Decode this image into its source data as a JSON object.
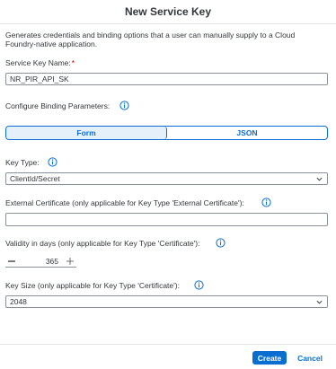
{
  "dialog": {
    "title": "New Service Key",
    "description": "Generates credentials and binding options that a user can manually supply to a Cloud Foundry-native application."
  },
  "fields": {
    "service_key_name_label": "Service Key Name:",
    "required_marker": "*",
    "service_key_name_value": "NR_PIR_API_SK",
    "configure_binding_label": "Configure Binding Parameters:",
    "mode_options": [
      "Form",
      "JSON"
    ],
    "mode_selected": "Form",
    "key_type_label": "Key Type:",
    "key_type_value": "ClientId/Secret",
    "external_certificate_label": "External Certificate (only applicable for Key Type 'External Certificate'):",
    "external_certificate_value": "",
    "validity_label": "Validity in days (only applicable for Key Type 'Certificate'):",
    "validity_value": "365",
    "key_size_label": "Key Size (only applicable for Key Type 'Certificate'):",
    "key_size_value": "2048"
  },
  "footer": {
    "create_label": "Create",
    "cancel_label": "Cancel"
  },
  "colors": {
    "accent": "#0a6ed1",
    "required": "#bb0000",
    "text": "#32363a",
    "border": "#89919a"
  },
  "icons": {
    "info": "info-icon",
    "dropdown": "chevron-down-icon",
    "decrement": "minus-icon",
    "increment": "plus-icon"
  }
}
